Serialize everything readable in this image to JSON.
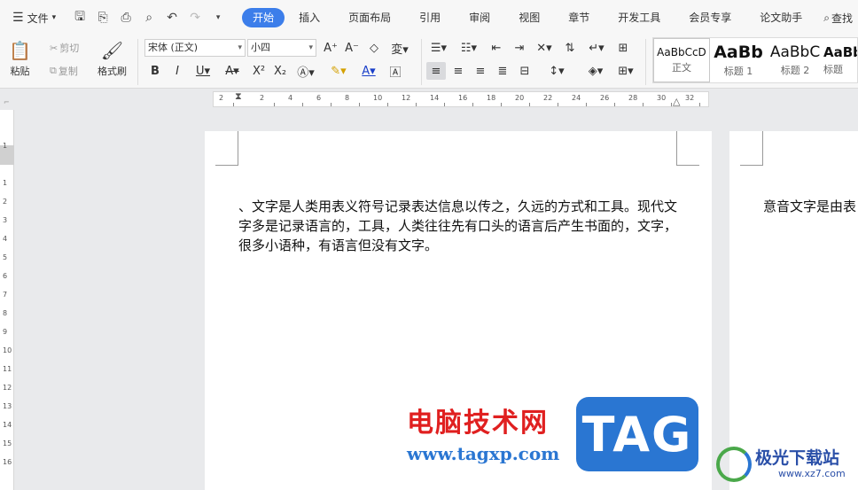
{
  "menubar": {
    "file_label": "文件",
    "tabs": [
      "开始",
      "插入",
      "页面布局",
      "引用",
      "审阅",
      "视图",
      "章节",
      "开发工具",
      "会员专享",
      "论文助手"
    ],
    "search_label": "查找"
  },
  "ribbon": {
    "paste_label": "粘贴",
    "cut_label": "剪切",
    "copy_label": "复制",
    "format_painter_label": "格式刷",
    "font_name": "宋体 (正文)",
    "font_size": "小四",
    "styles": [
      {
        "preview": "AaBbCcD",
        "name": "正文"
      },
      {
        "preview": "AaBb",
        "name": "标题 1"
      },
      {
        "preview": "AaBbC",
        "name": "标题 2"
      },
      {
        "preview": "AaBb",
        "name": "标题"
      }
    ]
  },
  "ruler": {
    "h_marks": [
      "2",
      "2",
      "4",
      "6",
      "8",
      "10",
      "12",
      "14",
      "16",
      "18",
      "20",
      "22",
      "24",
      "26",
      "28",
      "30",
      "32"
    ],
    "v_marks": [
      "1",
      "1",
      "2",
      "3",
      "4",
      "5",
      "6",
      "7",
      "8",
      "9",
      "10",
      "11",
      "12",
      "13",
      "14",
      "15",
      "16"
    ]
  },
  "document": {
    "page1_text": "、文字是人类用表义符号记录表达信息以传之，久远的方式和工具。现代文字多是记录语言的，工具，人类往往先有口头的语言后产生书面的，文字，很多小语种，有语言但没有文字。",
    "page2_text": "意音文字是由表"
  },
  "watermark": {
    "site_name": "电脑技术网",
    "site_url": "www.tagxp.com",
    "tag_logo": "TAG",
    "site2_name": "极光下载站",
    "site2_url": "www.xz7.com"
  }
}
